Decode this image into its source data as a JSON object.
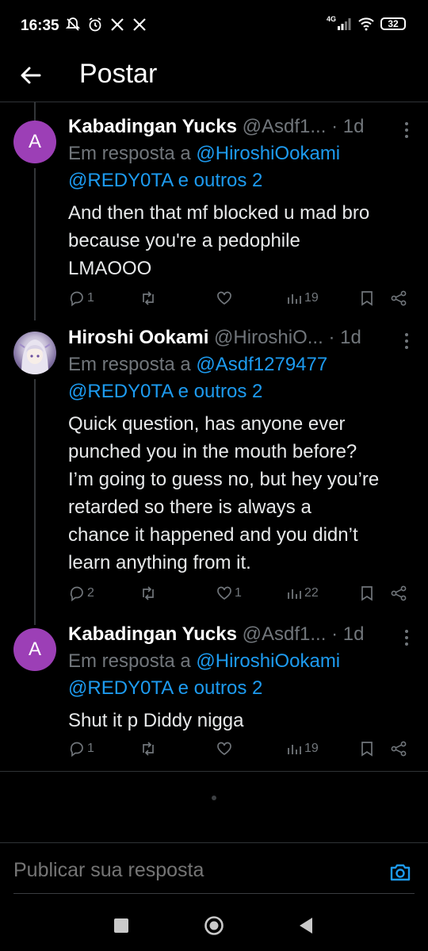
{
  "status_bar": {
    "time": "16:35",
    "network": "4G",
    "battery": "32"
  },
  "header": {
    "title": "Postar"
  },
  "tweets": [
    {
      "avatar_letter": "A",
      "name": "Kabadingan Yucks",
      "handle": "@Asdf1...",
      "time": "· 1d",
      "reply_prefix": "Em resposta a",
      "reply_mentions": "@HiroshiOokami",
      "reply_line2_mention": "@REDY0TA",
      "reply_suffix": "e outros 2",
      "text": "And then that mf blocked u mad bro\nbecause you're a pedophile\nLMAOOO",
      "replies": "1",
      "retweets": "",
      "likes": "",
      "views": "19"
    },
    {
      "avatar_letter": "",
      "name": "Hiroshi Ookami",
      "handle": "@HiroshiO...",
      "time": "· 1d",
      "reply_prefix": "Em resposta a",
      "reply_mentions": "@Asdf1279477",
      "reply_line2_mention": "@REDY0TA",
      "reply_suffix": "e outros 2",
      "text": "Quick question, has anyone ever\npunched you in the mouth before?\nI’m going to guess no, but hey you’re\nretarded so there is always a\nchance it happened and you didn’t\nlearn anything from it.",
      "replies": "2",
      "retweets": "",
      "likes": "1",
      "views": "22"
    },
    {
      "avatar_letter": "A",
      "name": "Kabadingan Yucks",
      "handle": "@Asdf1...",
      "time": "· 1d",
      "reply_prefix": "Em resposta a",
      "reply_mentions": "@HiroshiOokami",
      "reply_line2_mention": "@REDY0TA",
      "reply_suffix": "e outros 2",
      "text": "Shut it p Diddy nigga",
      "replies": "1",
      "retweets": "",
      "likes": "",
      "views": "19"
    }
  ],
  "reply_bar": {
    "placeholder": "Publicar sua resposta"
  },
  "colors": {
    "background": "#000000",
    "accent": "#1d9bf0",
    "muted": "#71767b",
    "avatar_purple": "#9c3fb6"
  }
}
